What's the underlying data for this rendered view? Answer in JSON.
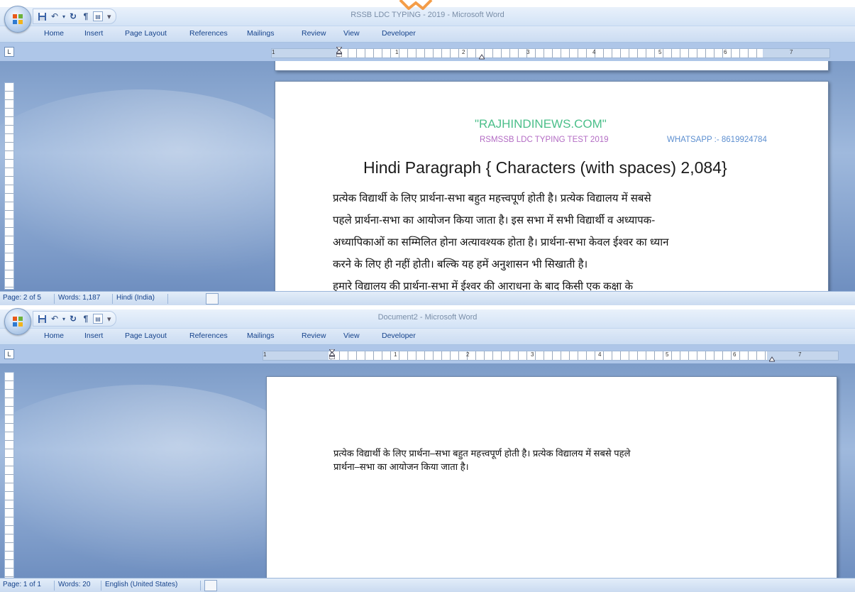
{
  "top_window": {
    "title": "RSSB LDC TYPING - 2019 - Microsoft Word",
    "tabs": [
      "Home",
      "Insert",
      "Page Layout",
      "References",
      "Mailings",
      "Review",
      "View",
      "Developer"
    ],
    "ruler_numbers": [
      "1",
      "1",
      "2",
      "3",
      "4",
      "5",
      "6",
      "7"
    ],
    "doc": {
      "website": "\"RAJHINDINEWS.COM\"",
      "test": "RSMSSB LDC TYPING TEST 2019",
      "whatsapp": "WHATSAPP :- 8619924784",
      "heading": "Hindi Paragraph { Characters (with spaces)  2,084}",
      "lines": [
        "प्रत्येक विद्यार्थी के लिए प्रार्थना-सभा बहुत महत्त्वपूर्ण होती है। प्रत्येक विद्यालय में सबसे",
        "पहले प्रार्थना-सभा का आयोजन किया जाता है। इस सभा में सभी विद्यार्थी व अध्यापक-",
        "अध्यापिकाओं का सम्मिलित होना अत्यावश्यक होता है। प्रार्थना-सभा केवल ईश्वर का ध्यान",
        "करने के लिए ही नहीं होती। बल्कि यह हमें अनुशासन भी सिखाती है।",
        "हमारे विद्यालय की प्रार्थना-सभा में ईश्वर की आराधना के बाद किसी एक कक्षा के"
      ]
    },
    "status": {
      "page": "Page: 2 of 5",
      "words": "Words: 1,187",
      "language": "Hindi (India)"
    },
    "colors": {
      "website": "#4bbf8a",
      "test": "#b36cc4",
      "whatsapp": "#5d8fd0"
    }
  },
  "bottom_window": {
    "title": "Document2 - Microsoft Word",
    "tabs": [
      "Home",
      "Insert",
      "Page Layout",
      "References",
      "Mailings",
      "Review",
      "View",
      "Developer"
    ],
    "ruler_numbers": [
      "1",
      "1",
      "2",
      "3",
      "4",
      "5",
      "6",
      "7"
    ],
    "doc": {
      "lines": [
        "प्रत्येक विद्यार्थी के लिए प्रार्थना–सभा बहुत महत्त्वपूर्ण होती है। प्रत्येक विद्यालय में सबसे पहले",
        "प्रार्थना–सभा का आयोजन किया जाता है।"
      ]
    },
    "status": {
      "page": "Page: 1 of 1",
      "words": "Words: 20",
      "language": "English (United States)"
    }
  },
  "icons": {
    "office": "office-button-icon",
    "save": "save-icon",
    "undo": "undo-icon",
    "redo": "redo-icon",
    "pilcrow": "show-formatting-icon",
    "print": "print-preview-icon"
  },
  "accent_colors": {
    "titlebar": "#d3e3f6",
    "canvas": "#8fadd8",
    "watermark": "#f28c28"
  }
}
